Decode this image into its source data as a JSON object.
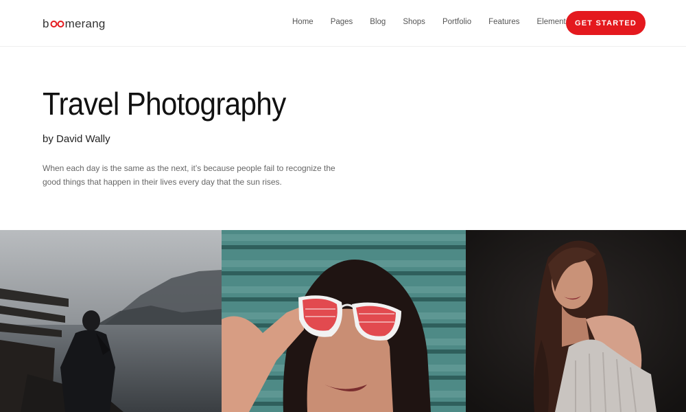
{
  "header": {
    "logo_prefix": "b",
    "logo_suffix": "merang",
    "nav": [
      "Home",
      "Pages",
      "Blog",
      "Shops",
      "Portfolio",
      "Features",
      "Elements"
    ],
    "cta_label": "GET STARTED"
  },
  "hero": {
    "title": "Travel Photography",
    "byline": "by David Wally",
    "description": "When each day is the same as the next, it’s because people fail to recognize the good things that happen in their lives every day that the sun rises."
  },
  "colors": {
    "accent": "#e4191e",
    "text_dark": "#111111",
    "text_muted": "#666666"
  },
  "icons": {
    "logo_mark": "infinity-icon"
  }
}
